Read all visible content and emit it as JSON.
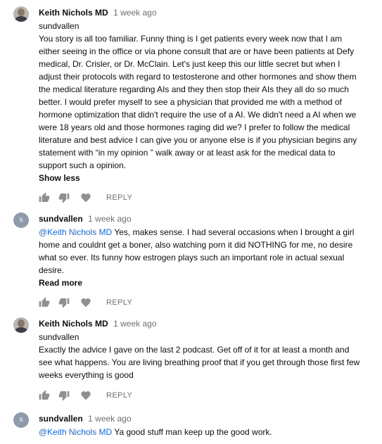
{
  "comments": [
    {
      "author": "Keith Nichols MD",
      "timestamp": "1 week ago",
      "avatar_icon": "user-photo-avatar",
      "reply_to": "sundvallen",
      "text": "You story is all too familiar. Funny thing is I get patients every week now that I am either seeing in the office or via phone consult that are or have been patients at Defy medical, Dr. Crisler, or Dr. McClain.  Let's just keep this our little secret but when I adjust their protocols with regard to testosterone and other hormones and show them the medical literature regarding AIs and they then stop their AIs they all do so much better.   I would prefer myself to see a physician that provided me with a method of hormone optimization that didn't require the use of a AI.  We didn't need a AI when we were 18 years old and those hormones raging did we? I prefer to follow the medical literature and best advice I can give you or anyone else is if you physician begins any statement with “in my opinion ” walk away or at least ask for the medical data to support such a opinion.",
      "toggle_label": "Show less",
      "reply_label": "REPLY"
    },
    {
      "author": "sundvallen",
      "timestamp": "1 week ago",
      "avatar_letter": "s",
      "mention": "@Keith Nichols MD",
      "text": " Yes, makes sense. I had several occasions when I brought a girl home and couldnt get a boner, also watching porn it did NOTHING for me, no desire what so ever. Its funny how estrogen plays such an important role in actual sexual desire.",
      "toggle_label": "Read more",
      "reply_label": "REPLY"
    },
    {
      "author": "Keith Nichols MD",
      "timestamp": "1 week ago",
      "avatar_icon": "user-photo-avatar",
      "reply_to": "sundvallen",
      "text": "Exactly the advice I gave on the last 2 podcast. Get off of it for at least a month and see what happens. You are living breathing proof that if you get through those first few weeks everything is good",
      "reply_label": "REPLY"
    },
    {
      "author": "sundvallen",
      "timestamp": "1 week ago",
      "avatar_letter": "s",
      "mention": "@Keith Nichols MD",
      "text": " Ya good stuff man keep up the good work."
    }
  ],
  "icons": {
    "like": "thumbs-up-icon",
    "dislike": "thumbs-down-icon",
    "heart": "heart-icon"
  },
  "colors": {
    "mention": "#1a67c9",
    "secondary_text": "#6f6f6f",
    "letter_avatar": "#8d9bab"
  }
}
